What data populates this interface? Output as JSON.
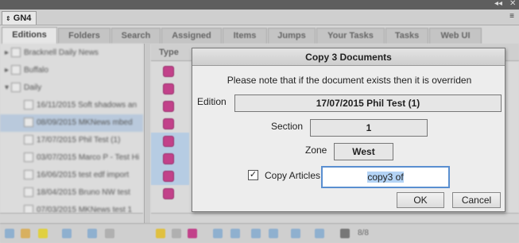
{
  "panel": {
    "title": "GN4",
    "collapse_glyph": "◂◂",
    "close_glyph": "✕",
    "menu_glyph": "≡"
  },
  "tabs": [
    {
      "label": "Editions"
    },
    {
      "label": "Folders"
    },
    {
      "label": "Search"
    },
    {
      "label": "Assigned"
    },
    {
      "label": "Items"
    },
    {
      "label": "Jumps"
    },
    {
      "label": "Your Tasks"
    },
    {
      "label": "Tasks"
    },
    {
      "label": "Web UI"
    }
  ],
  "tree": {
    "rows": [
      {
        "label": "Bracknell Daily News"
      },
      {
        "label": "Buffalo"
      },
      {
        "label": "Daily"
      },
      {
        "label": "16/11/2015 Soft shadows an"
      },
      {
        "label": "08/09/2015 MKNews mbed"
      },
      {
        "label": "17/07/2015 Phil Test (1)"
      },
      {
        "label": "03/07/2015 Marco P - Test Hi"
      },
      {
        "label": "16/06/2015 test edf import"
      },
      {
        "label": "18/04/2015 Bruno NW test"
      },
      {
        "label": "07/03/2015 MKNews test 1"
      }
    ]
  },
  "list": {
    "type_header": "Type"
  },
  "footer": {
    "page_count": "8/8"
  },
  "dialog": {
    "title": "Copy 3 Documents",
    "note": "Please note that if the document exists then it is overriden",
    "edition_label": "Edition",
    "edition_value": "17/07/2015 Phil Test (1)",
    "section_label": "Section",
    "section_value": "1",
    "zone_label": "Zone",
    "zone_value": "West",
    "copy_articles_label": "Copy Articles",
    "copy_articles_checked": "✓",
    "copy_prefix_value": "copy3 of",
    "ok_label": "OK",
    "cancel_label": "Cancel"
  },
  "colors": {
    "doc_icon": "#c2418a",
    "selection": "#b6cce3",
    "focus_border": "#5a8fd0"
  }
}
